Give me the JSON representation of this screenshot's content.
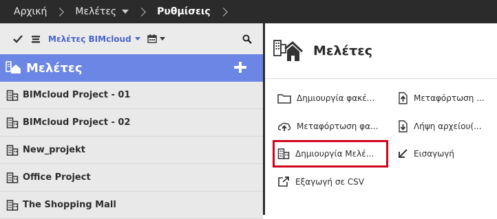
{
  "breadcrumb": {
    "items": [
      {
        "label": "Αρχική"
      },
      {
        "label": "Μελέτες"
      },
      {
        "label": "Ρυθμίσεις"
      }
    ]
  },
  "toolbar": {
    "filter_label": "Μελέτες BIMcloud"
  },
  "left_header": {
    "title": "Μελέτες"
  },
  "projects": [
    {
      "name": "BIMcloud Project - 01"
    },
    {
      "name": "BIMcloud Project - 02"
    },
    {
      "name": "New_projekt"
    },
    {
      "name": "Office Project"
    },
    {
      "name": "The Shopping Mall"
    }
  ],
  "right_panel": {
    "title": "Μελέτες",
    "actions": {
      "create_folder": "Δημιουργία φακέ...",
      "upload_right": "Μεταφόρτωση ...",
      "upload_left": "Μεταφόρτωση φα...",
      "download": "Λήψη αρχείου(...",
      "create_project": "Δημιουργία Μελέ...",
      "import": "Εισαγωγή",
      "export_csv": "Εξαγωγή σε CSV"
    }
  },
  "colors": {
    "topbar": "#2b2b2b",
    "accent": "#6b86e4",
    "link": "#4a64c8",
    "highlight": "#d0021b"
  }
}
